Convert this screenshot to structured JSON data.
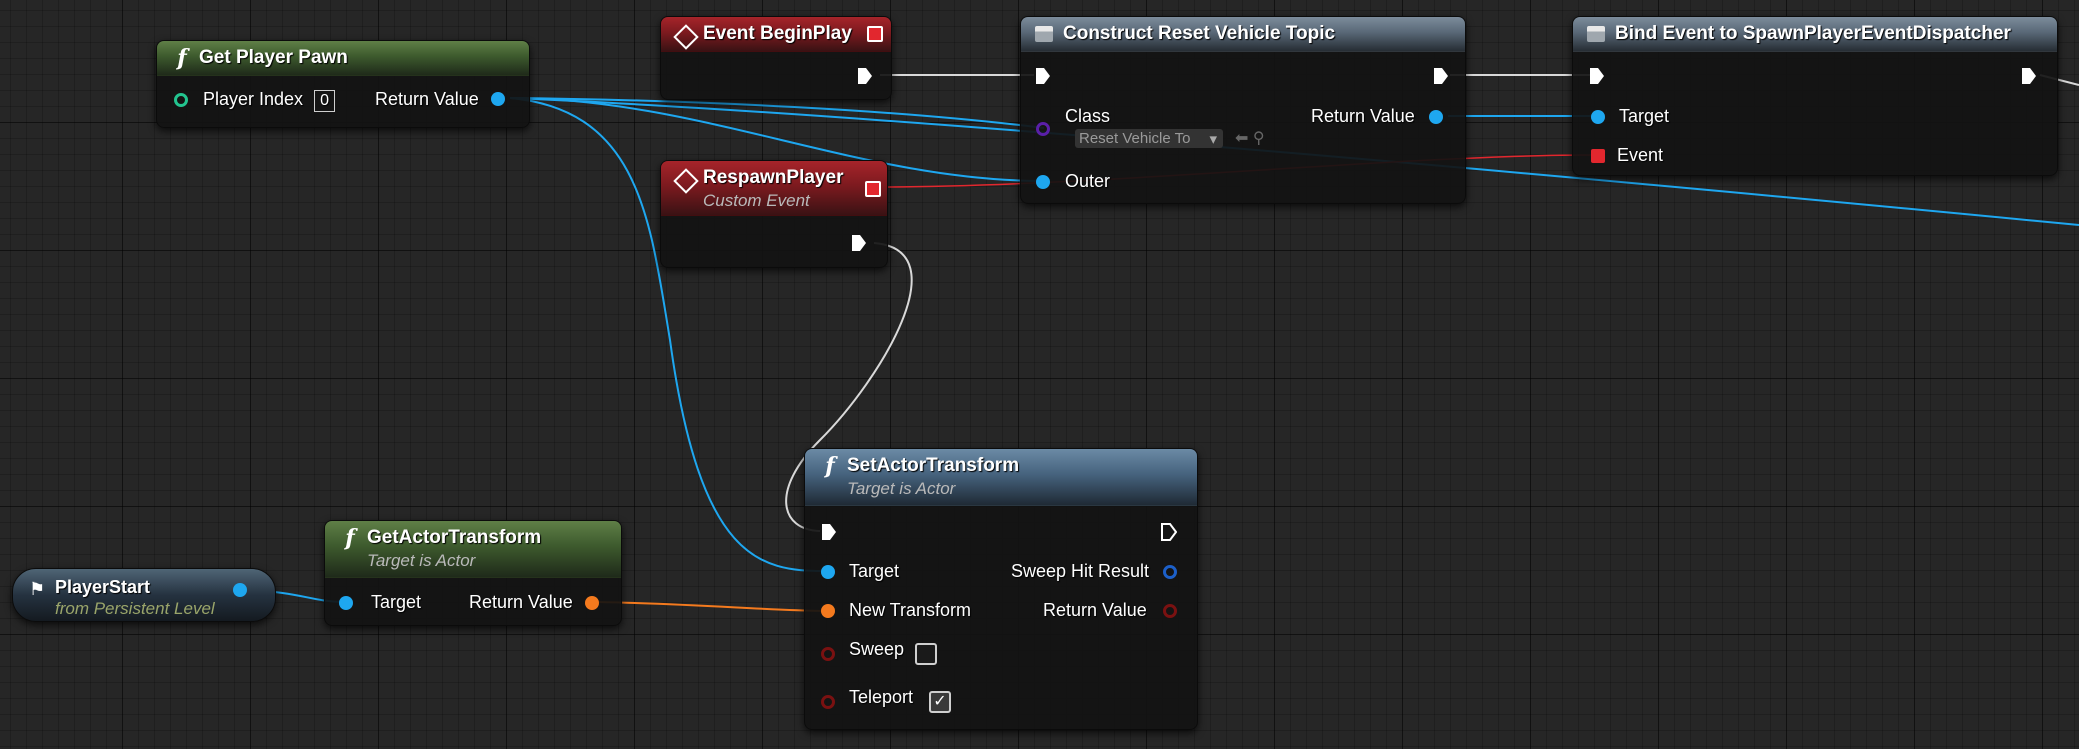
{
  "nodes": {
    "get_player_pawn": {
      "title": "Get Player Pawn",
      "player_index_label": "Player Index",
      "player_index_value": "0",
      "return_value_label": "Return Value"
    },
    "event_beginplay": {
      "title": "Event BeginPlay"
    },
    "respawn_player": {
      "title": "RespawnPlayer",
      "subtitle": "Custom Event"
    },
    "construct_reset": {
      "title": "Construct Reset Vehicle Topic",
      "class_label": "Class",
      "class_value": "Reset Vehicle To",
      "return_value_label": "Return Value",
      "outer_label": "Outer"
    },
    "bind_event": {
      "title": "Bind Event to SpawnPlayerEventDispatcher",
      "target_label": "Target",
      "event_label": "Event"
    },
    "set_actor_transform": {
      "title": "SetActorTransform",
      "subtitle": "Target is Actor",
      "target_label": "Target",
      "new_transform_label": "New Transform",
      "sweep_label": "Sweep",
      "teleport_label": "Teleport",
      "sweep_hit_result_label": "Sweep Hit Result",
      "return_value_label": "Return Value",
      "sweep_checked": false,
      "teleport_checked": true
    },
    "get_actor_transform": {
      "title": "GetActorTransform",
      "subtitle": "Target is Actor",
      "target_label": "Target",
      "return_value_label": "Return Value"
    },
    "player_start": {
      "title": "PlayerStart",
      "subtitle": "from Persistent Level"
    }
  },
  "colors": {
    "object_pin": "#1ea7f0",
    "transform_pin": "#f47a1e",
    "exec_wire": "#d9d9d9",
    "event_wire": "#e2272e",
    "function_header": "#3d5a2d",
    "event_header": "#7d1a1f"
  },
  "icons": {
    "function": "function-icon",
    "event": "event-diamond-icon",
    "construct": "construct-object-icon",
    "variable": "actor-variable-icon"
  }
}
